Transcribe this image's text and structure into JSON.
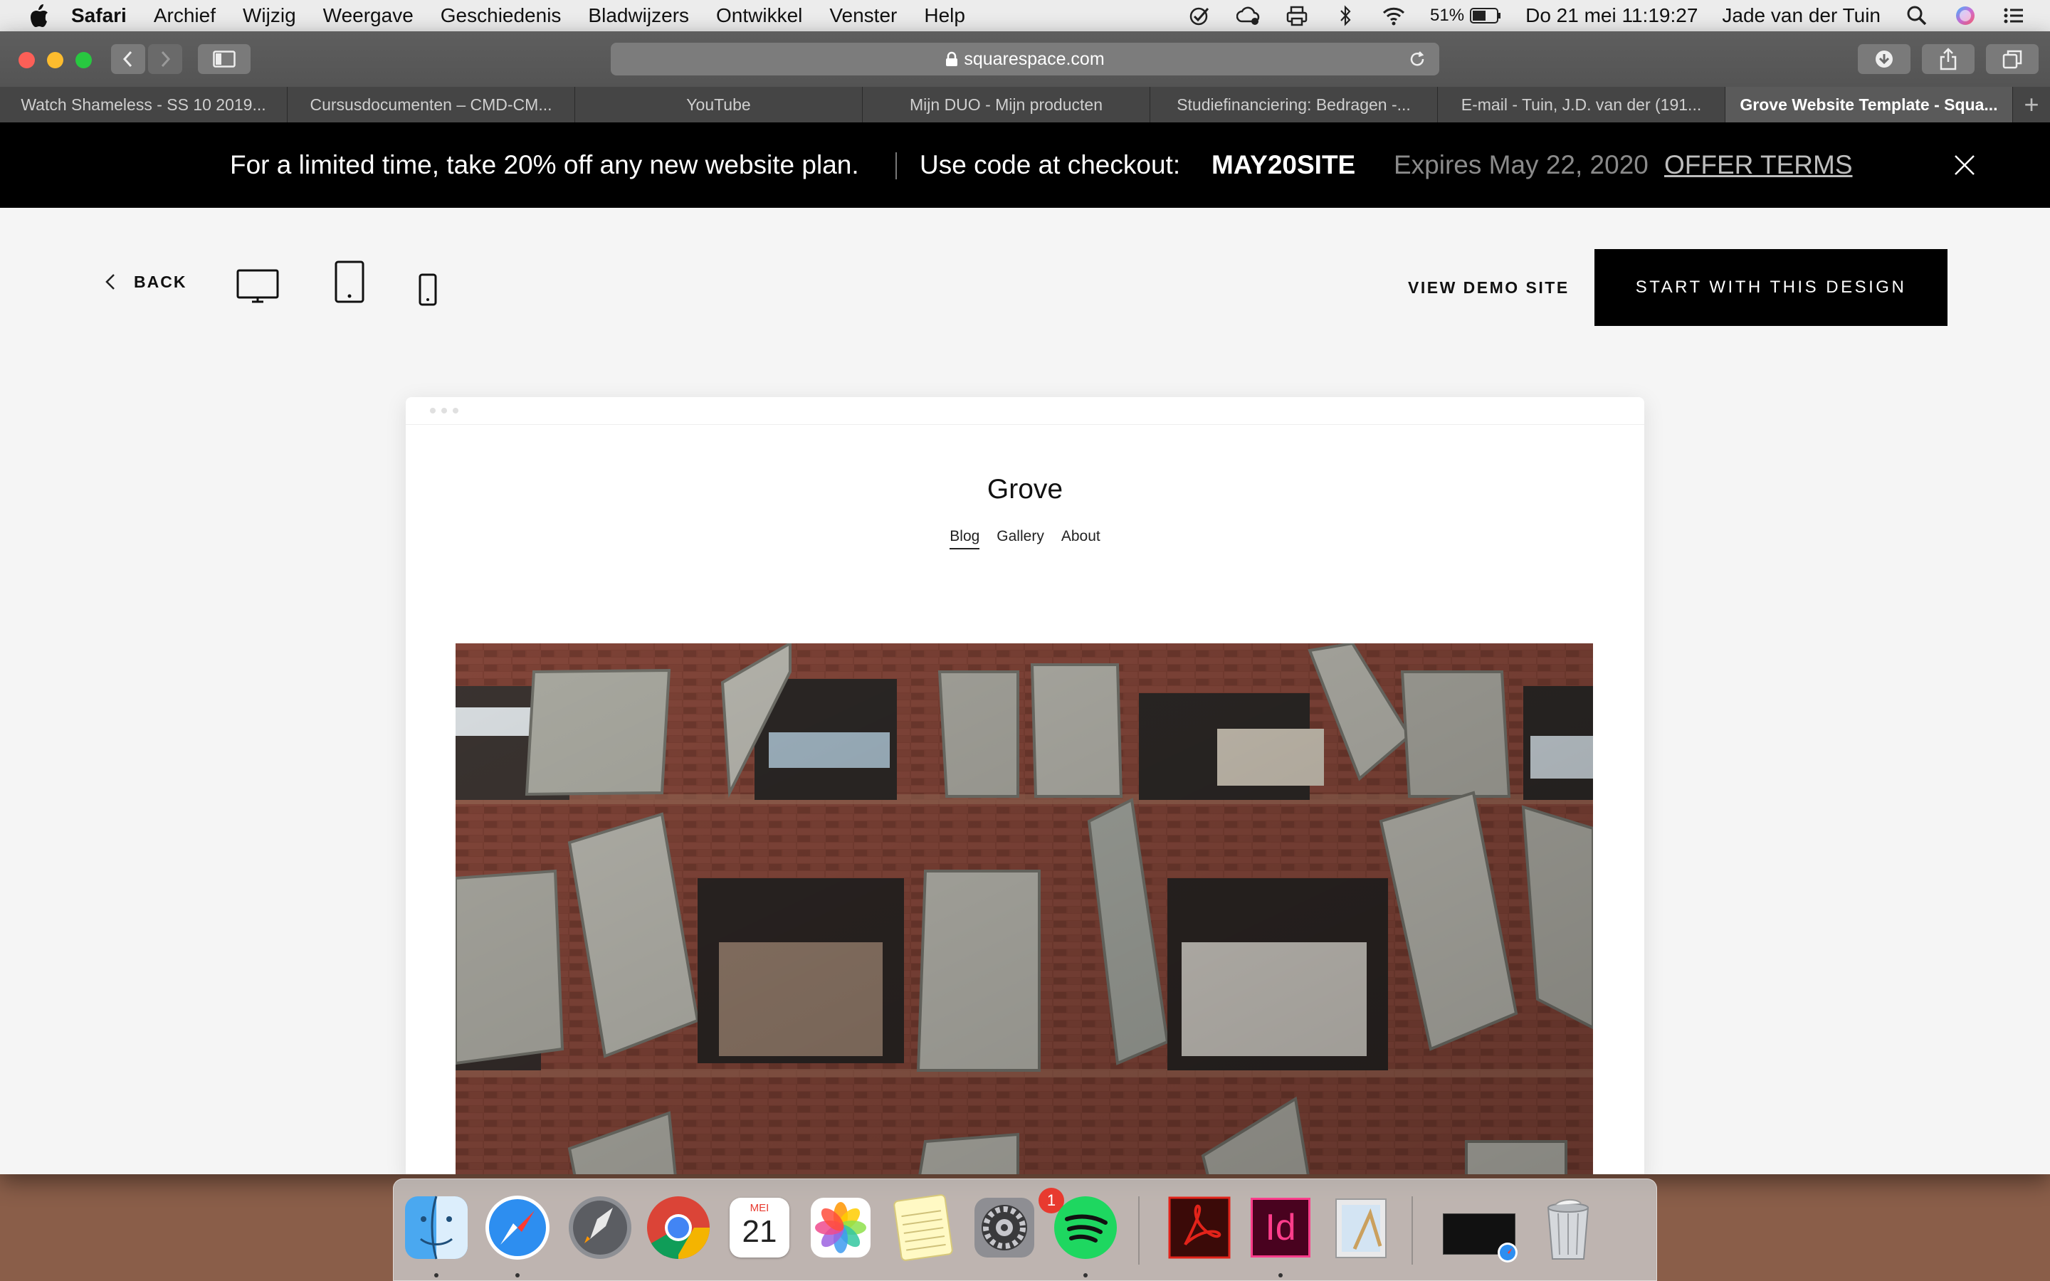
{
  "menubar": {
    "app": "Safari",
    "items": [
      "Archief",
      "Wijzig",
      "Weergave",
      "Geschiedenis",
      "Bladwijzers",
      "Ontwikkel",
      "Venster",
      "Help"
    ],
    "battery": "51%",
    "datetime": "Do 21 mei  11:19:27",
    "user": "Jade van der Tuin"
  },
  "browser": {
    "url": "squarespace.com",
    "tabs": [
      "Watch Shameless - SS 10 2019...",
      "Cursusdocumenten – CMD-CM...",
      "YouTube",
      "Mijn DUO - Mijn producten",
      "Studiefinanciering: Bedragen -...",
      "E-mail - Tuin, J.D. van der (191...",
      "Grove Website Template - Squa..."
    ],
    "new_tab": "+"
  },
  "promo": {
    "text": "For a limited time, take 20% off any new website plan.",
    "code_label": "Use code at checkout:",
    "code": "MAY20SITE",
    "expires": "Expires May 22, 2020",
    "terms": "OFFER TERMS"
  },
  "toolbar": {
    "back": "BACK",
    "view_demo": "VIEW DEMO SITE",
    "start": "START WITH THIS DESIGN"
  },
  "preview": {
    "site_title": "Grove",
    "nav": [
      "Blog",
      "Gallery",
      "About"
    ],
    "active_nav": "Blog"
  },
  "dock": {
    "calendar_month": "MEI",
    "calendar_day": "21",
    "badge": "1",
    "indesign_label": "Id"
  }
}
